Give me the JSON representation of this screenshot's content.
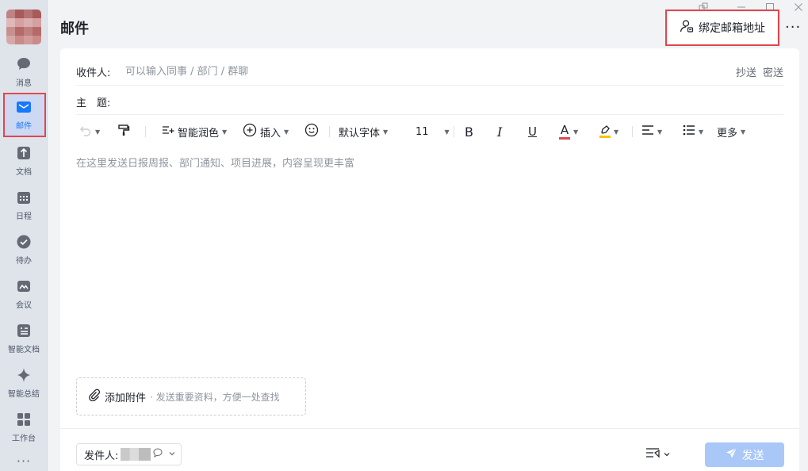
{
  "sidebar": {
    "items": [
      {
        "label": "消息",
        "icon": "chat-bubble-icon"
      },
      {
        "label": "邮件",
        "icon": "mail-icon",
        "active": true
      },
      {
        "label": "文档",
        "icon": "doc-icon"
      },
      {
        "label": "日程",
        "icon": "calendar-icon"
      },
      {
        "label": "待办",
        "icon": "check-circle-icon"
      },
      {
        "label": "会议",
        "icon": "meeting-icon"
      },
      {
        "label": "智能文档",
        "icon": "smart-doc-icon"
      },
      {
        "label": "智能总结",
        "icon": "sparkle-icon"
      },
      {
        "label": "工作台",
        "icon": "grid-icon"
      }
    ],
    "more": "···"
  },
  "header": {
    "title": "邮件",
    "bind_button": "绑定邮箱地址",
    "more": "···"
  },
  "compose": {
    "to_label": "收件人:",
    "to_placeholder": "可以输入同事 / 部门 / 群聊",
    "cc": "抄送",
    "bcc": "密送",
    "subject_label": "主　题:",
    "subject_value": "",
    "toolbar": {
      "polish": "智能润色",
      "insert": "插入",
      "font": "默认字体",
      "size": "11",
      "bold": "B",
      "italic": "I",
      "underline": "U",
      "color": "A",
      "more": "更多"
    },
    "body_placeholder": "在这里发送日报周报、部门通知、项目进展，内容呈现更丰富",
    "attach_label": "添加附件",
    "attach_hint": "· 发送重要资料，方便一处查找",
    "sender_label": "发件人:",
    "send": "发送"
  },
  "colors": {
    "accent": "#1677ff",
    "highlight": "#e0464f",
    "send_disabled": "#a9c8f7",
    "font_color_bar": "#e0464f",
    "highlighter_bar": "#f5c400"
  }
}
